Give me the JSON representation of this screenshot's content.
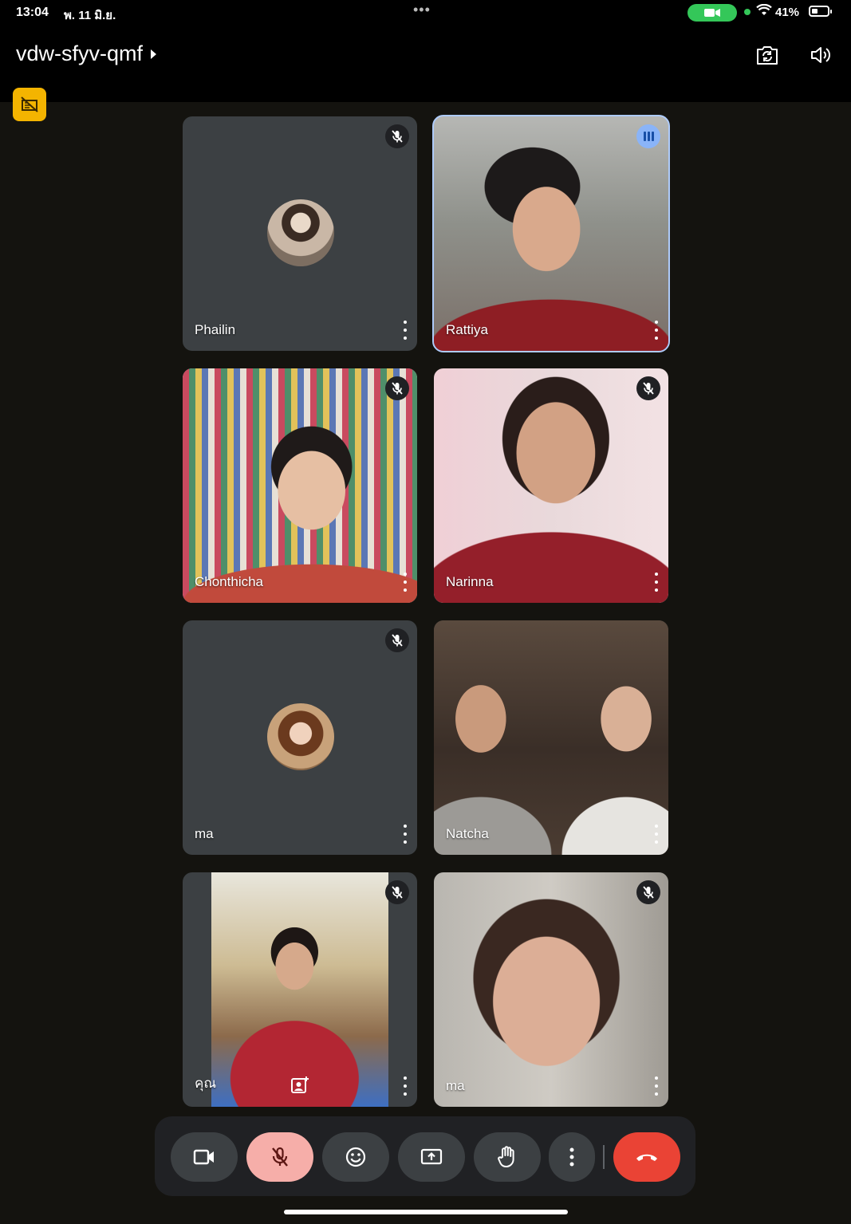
{
  "status_bar": {
    "time": "13:04",
    "date": "พ. 11 มิ.ย.",
    "battery_percent": "41%",
    "battery_level": 0.41,
    "icons": [
      "camera-in-use-icon",
      "wifi-icon",
      "battery-icon"
    ]
  },
  "header": {
    "meeting_code": "vdw-sfyv-qmf",
    "icons": [
      "switch-camera-icon",
      "speaker-icon",
      "video-off-badge-icon"
    ]
  },
  "participants": [
    {
      "name": "Phailin",
      "muted": true,
      "video": false
    },
    {
      "name": "Rattiya",
      "muted": false,
      "speaking": true,
      "video": true
    },
    {
      "name": "Chonthicha",
      "muted": true,
      "video": true
    },
    {
      "name": "Narinna",
      "muted": true,
      "video": true
    },
    {
      "name": "ma",
      "muted": true,
      "video": false
    },
    {
      "name": "Natcha",
      "muted": false,
      "video": true
    },
    {
      "name": "คุณ",
      "muted": true,
      "video": true,
      "self": true
    },
    {
      "name": "ma",
      "muted": true,
      "video": true
    }
  ],
  "controls": {
    "buttons": [
      "camera",
      "microphone-off",
      "reactions",
      "present-screen",
      "raise-hand",
      "more-options",
      "end-call"
    ]
  },
  "colors": {
    "background": "#14130f",
    "tile": "#3c4043",
    "mic_off_active": "#f6aea9",
    "end_call": "#ea4335",
    "speaking": "#8ab4f8",
    "badge": "#f4b400"
  }
}
